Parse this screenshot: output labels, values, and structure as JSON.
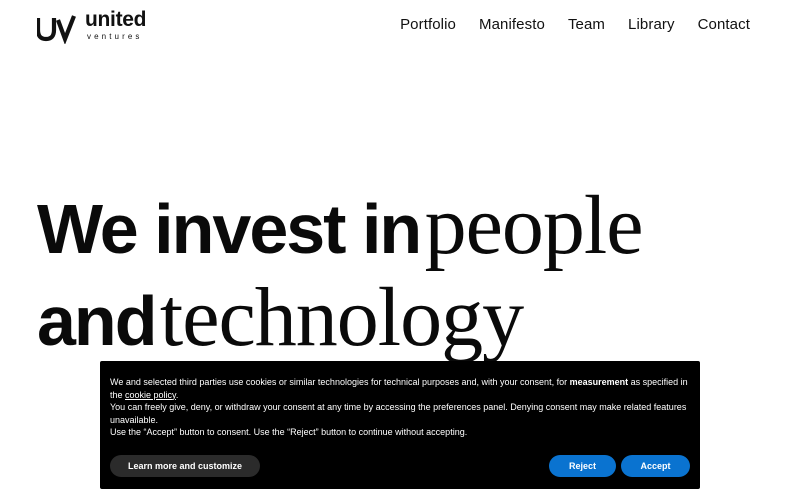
{
  "header": {
    "logo": {
      "word": "united",
      "subword": "ventures",
      "mark_icon": "uv-monogram-icon"
    },
    "nav": [
      {
        "label": "Portfolio"
      },
      {
        "label": "Manifesto"
      },
      {
        "label": "Team"
      },
      {
        "label": "Library"
      },
      {
        "label": "Contact"
      }
    ]
  },
  "hero": {
    "line1_bold": "We invest in",
    "line1_serif": "people",
    "line2_bold": "and",
    "line2_serif": "technology"
  },
  "cookie_banner": {
    "p1_before": "We and selected third parties use cookies or similar technologies for technical purposes and, with your consent, for ",
    "p1_bold": "measurement",
    "p1_after": " as specified in the ",
    "p1_link": "cookie policy",
    "p1_end": ".",
    "p2": "You can freely give, deny, or withdraw your consent at any time by accessing the preferences panel. Denying consent may make related features unavailable.",
    "p3": "Use the “Accept” button to consent. Use the “Reject” button to continue without accepting.",
    "buttons": {
      "customize": "Learn more and customize",
      "reject": "Reject",
      "accept": "Accept"
    },
    "colors": {
      "background": "#000000",
      "primary_button": "#0a73d0",
      "secondary_button": "#2b2b2b"
    }
  }
}
